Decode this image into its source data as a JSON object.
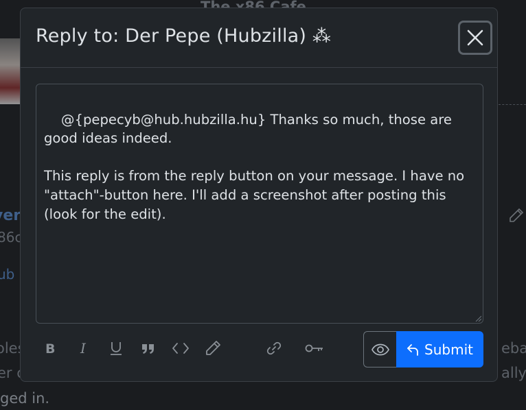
{
  "background": {
    "site_title": "The x86 Cafe",
    "side_text_1": "ver",
    "side_text_2": "86c",
    "side_text_3": "ub",
    "body_line_1": "oles",
    "body_line_2": "er c  p  g",
    "body_line_3": "ged in.",
    "right_text_1": "eba",
    "right_text_2": "ally"
  },
  "modal": {
    "title": "Reply to: Der Pepe (Hubzilla) ⁂",
    "close_icon": "close-icon",
    "message": "@{pepecyb@hub.hubzilla.hu} Thanks so much, those are good ideas indeed.\n\nThis reply is from the reply button on your message. I have no \"attach\"-button here. I'll add a screenshot after posting this (look for the edit).",
    "toolbar": [
      {
        "name": "bold-button",
        "icon": "bold-icon"
      },
      {
        "name": "italic-button",
        "icon": "italic-icon"
      },
      {
        "name": "underline-button",
        "icon": "underline-icon"
      },
      {
        "name": "quote-button",
        "icon": "quote-icon"
      },
      {
        "name": "code-button",
        "icon": "code-icon"
      },
      {
        "name": "edit-button",
        "icon": "pencil-icon"
      },
      {
        "name": "link-button",
        "icon": "link-icon"
      },
      {
        "name": "encrypt-button",
        "icon": "key-icon"
      }
    ],
    "preview_icon": "eye-icon",
    "submit_label": "Submit",
    "submit_icon": "reply-arrow-icon",
    "accent_color": "#0d6efd"
  }
}
